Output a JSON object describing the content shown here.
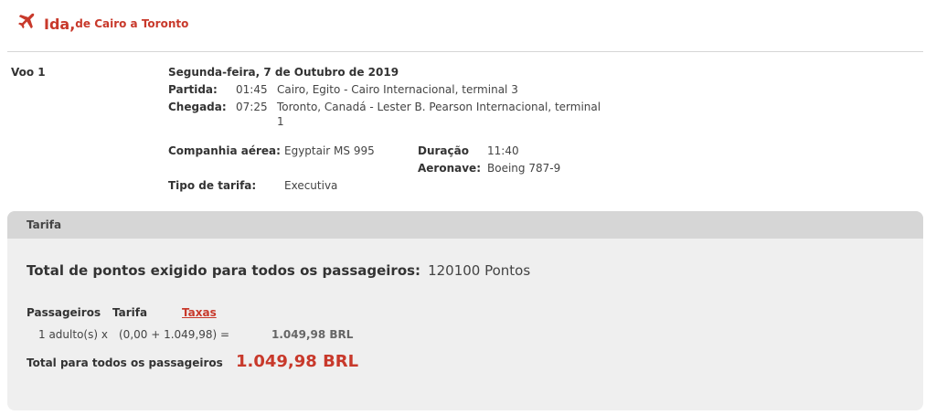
{
  "header": {
    "title": "Ida,",
    "subtitle": "de Cairo a Toronto"
  },
  "flight": {
    "label": "Voo 1",
    "date": "Segunda-feira, 7 de Outubro de 2019",
    "departure_label": "Partida:",
    "departure_time": "01:45",
    "departure_place": "Cairo, Egito - Cairo Internacional, terminal 3",
    "arrival_label": "Chegada:",
    "arrival_time": "07:25",
    "arrival_place_line1": "Toronto, Canadá - Lester B. Pearson Internacional, terminal",
    "arrival_place_line2": "1",
    "airline_label": "Companhia aérea:",
    "airline_value": "Egyptair MS 995",
    "duration_label": "Duração",
    "duration_value": "11:40",
    "aircraft_label": "Aeronave:",
    "aircraft_value": "Boeing 787-9",
    "fare_type_label": "Tipo de tarifa:",
    "fare_type_value": "Executiva"
  },
  "tarifa": {
    "header": "Tarifa",
    "total_points_label": "Total de pontos exigido para todos os passageiros:",
    "total_points_value": "120100 Pontos",
    "col_passengers": "Passageiros",
    "col_tarifa": "Tarifa",
    "col_taxas": "Taxas",
    "row_pax": "1 adulto(s) x",
    "row_calc": "(0,00 + 1.049,98) =",
    "row_amount": "1.049,98 BRL",
    "total_label": "Total para todos os passageiros",
    "total_amount": "1.049,98 BRL"
  },
  "colors": {
    "accent": "#c8392b",
    "panel_bg": "#efefef",
    "panel_header_bg": "#d6d6d6"
  },
  "icons": {
    "header_icon": "airplane-icon"
  }
}
